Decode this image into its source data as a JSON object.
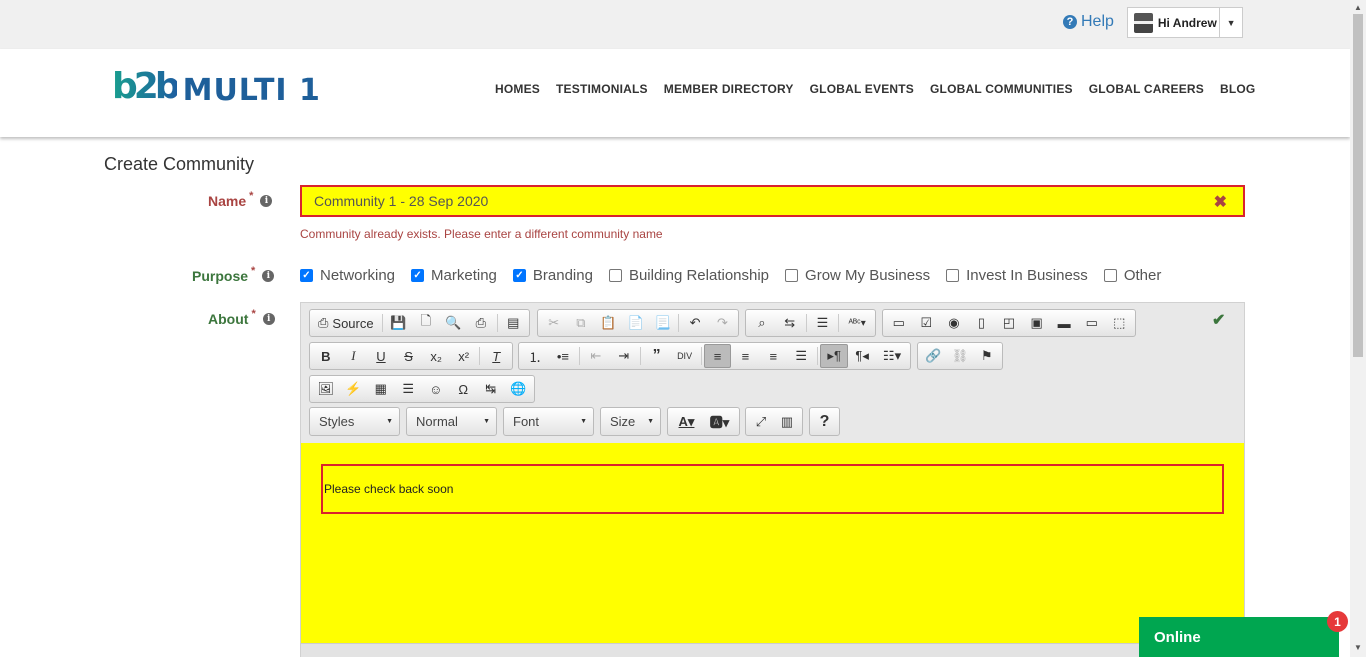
{
  "topbar": {
    "help_label": "Help",
    "user_greeting": "Hi Andrew"
  },
  "brand": {
    "logo_mark": "b2b",
    "logo_text": "MULTI 1"
  },
  "nav": {
    "items": [
      "HOMES",
      "TESTIMONIALS",
      "MEMBER DIRECTORY",
      "GLOBAL EVENTS",
      "GLOBAL COMMUNITIES",
      "GLOBAL CAREERS",
      "BLOG"
    ]
  },
  "page": {
    "title": "Create Community"
  },
  "form": {
    "name_label": "Name",
    "name_value": "Community 1 - 28 Sep 2020",
    "name_error": "Community already exists. Please enter a different community name",
    "purpose_label": "Purpose",
    "purposes": [
      {
        "label": "Networking",
        "checked": true
      },
      {
        "label": "Marketing",
        "checked": true
      },
      {
        "label": "Branding",
        "checked": true
      },
      {
        "label": "Building Relationship",
        "checked": false
      },
      {
        "label": "Grow My Business",
        "checked": false
      },
      {
        "label": "Invest In Business",
        "checked": false
      },
      {
        "label": "Other",
        "checked": false
      }
    ],
    "about_label": "About",
    "required_mark": "*"
  },
  "editor": {
    "source_label": "Source",
    "styles_label": "Styles",
    "format_label": "Normal",
    "font_label": "Font",
    "size_label": "Size",
    "content_text": "Please check back soon"
  },
  "chat": {
    "status_label": "Online",
    "badge_count": "1"
  },
  "colors": {
    "error_red": "#a94442",
    "success_green": "#3c763d",
    "highlight_yellow": "#ffff00",
    "chat_green": "#00a650",
    "link_blue": "#337ab7"
  }
}
